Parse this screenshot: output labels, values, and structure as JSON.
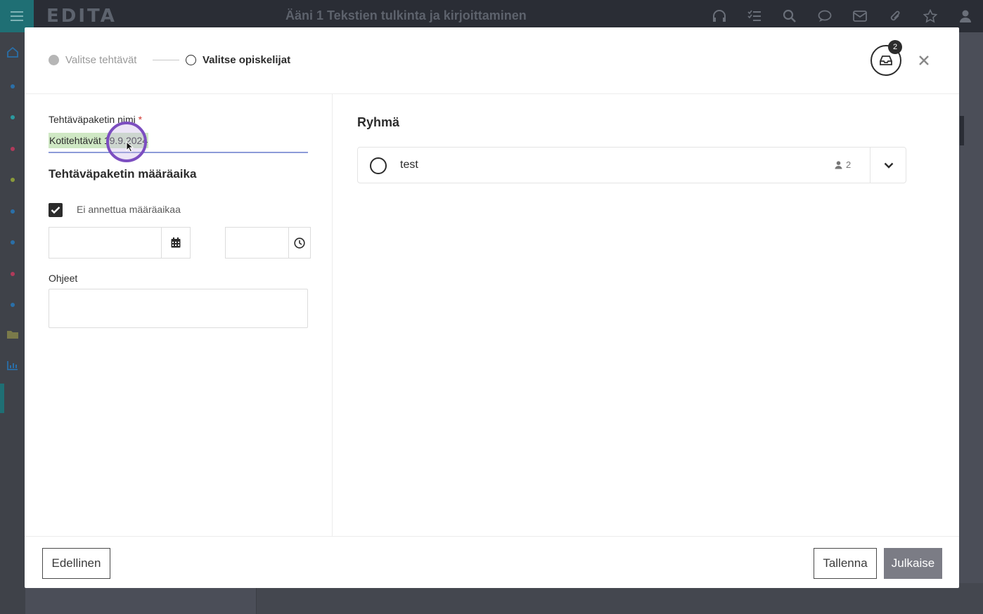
{
  "app": {
    "logo": "EDITA",
    "title": "Ääni 1 Tekstien tulkinta ja kirjoittaminen",
    "top_icons": [
      "headphones-icon",
      "checklist-icon",
      "search-icon",
      "chat-icon",
      "mail-icon",
      "paperclip-icon",
      "star-icon",
      "user-icon"
    ],
    "sidebar_dots": [
      "#2a6fa8",
      "#2a9aa0",
      "#b03a5a",
      "#8a9a3a",
      "#2a6fa8",
      "#2a6fa8",
      "#b03a5a",
      "#2a6fa8"
    ]
  },
  "modal": {
    "steps": [
      {
        "label": "Valitse tehtävät",
        "state": "done"
      },
      {
        "label": "Valitse opiskelijat",
        "state": "current"
      }
    ],
    "inbox_count": "2",
    "form": {
      "name_label": "Tehtäväpaketin nimi",
      "required_mark": "*",
      "name_value": "Kotitehtävät 19.9.2024",
      "deadline_title": "Tehtäväpaketin määräaika",
      "no_deadline_label": "Ei annettua määräaikaa",
      "no_deadline_checked": true,
      "instructions_label": "Ohjeet"
    },
    "groups": {
      "title": "Ryhmä",
      "items": [
        {
          "name": "test",
          "member_count": "2"
        }
      ]
    },
    "footer": {
      "previous_label": "Edellinen",
      "save_label": "Tallenna",
      "publish_label": "Julkaise"
    }
  }
}
